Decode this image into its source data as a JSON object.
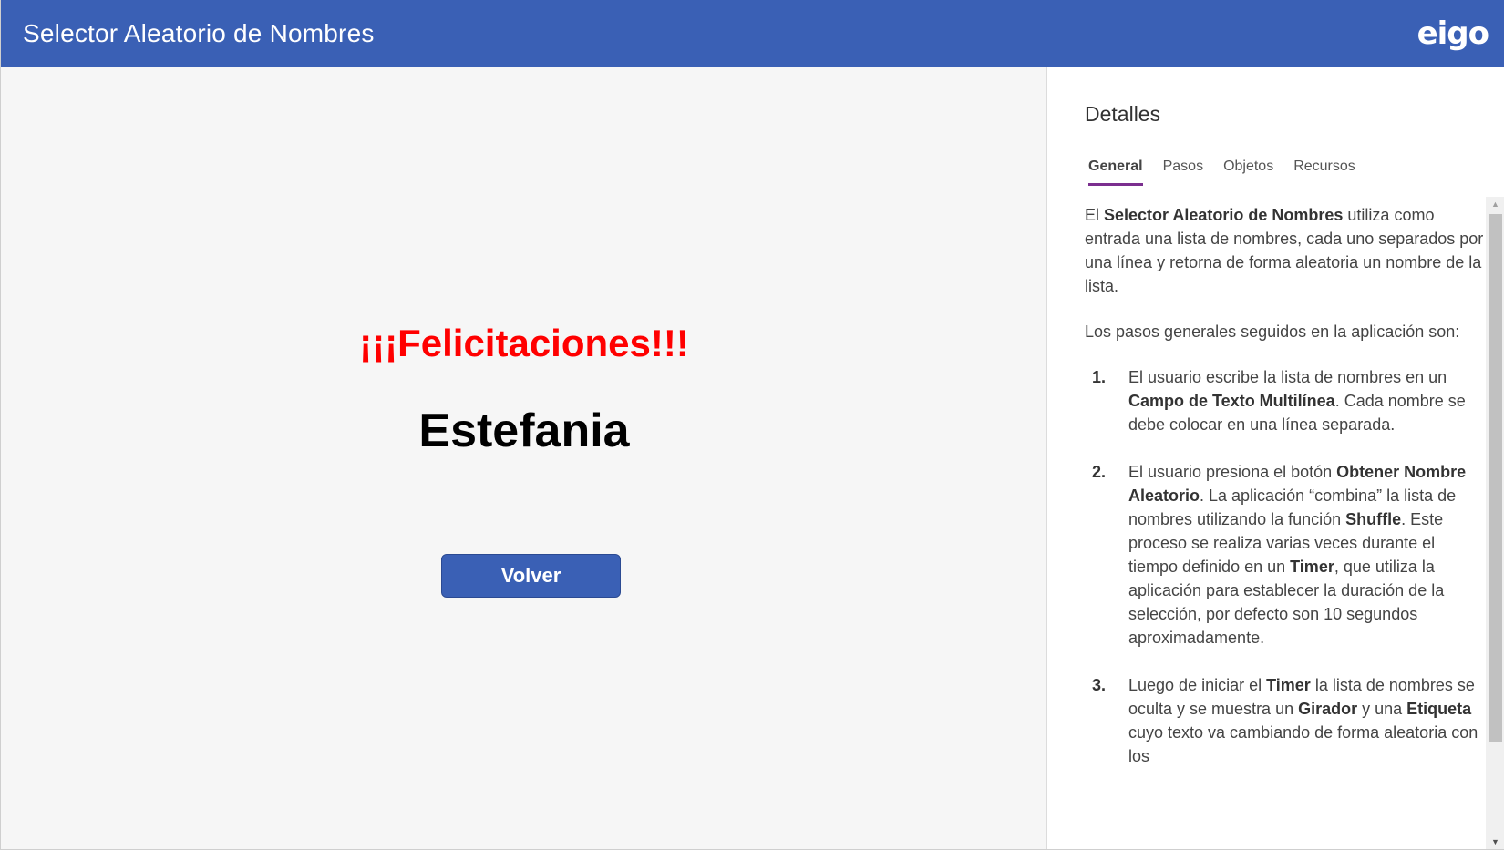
{
  "header": {
    "title": "Selector Aleatorio de Nombres",
    "logo": "eigo"
  },
  "main": {
    "congrats": "¡¡¡Felicitaciones!!!",
    "winner": "Estefania",
    "back_button": "Volver"
  },
  "details": {
    "heading": "Detalles",
    "tabs": [
      {
        "label": "General",
        "active": true
      },
      {
        "label": "Pasos",
        "active": false
      },
      {
        "label": "Objetos",
        "active": false
      },
      {
        "label": "Recursos",
        "active": false
      }
    ],
    "intro": {
      "pre": "El ",
      "bold": "Selector Aleatorio de Nombres",
      "post": " utiliza como entrada una lista de nombres, cada uno separados por una línea y retorna de forma aleatoria un nombre de la lista."
    },
    "steps_intro": "Los pasos generales seguidos en la aplicación son:",
    "steps": [
      {
        "num": "1.",
        "t1": "El usuario escribe la lista de nombres en un ",
        "b1": "Campo de Texto Multilínea",
        "t2": ". Cada nombre se debe colocar en una línea separada."
      },
      {
        "num": "2.",
        "t1": "El usuario presiona el botón ",
        "b1": "Obtener Nombre Aleatorio",
        "t2": ". La aplicación “combina” la lista de nombres utilizando la función ",
        "b2": "Shuffle",
        "t3": ". Este proceso se realiza varias veces durante el tiempo definido en un ",
        "b3": "Timer",
        "t4": ", que utiliza la aplicación para establecer la duración de la selección, por defecto son 10 segundos aproximadamente."
      },
      {
        "num": "3.",
        "t1": "Luego de iniciar el ",
        "b1": "Timer",
        "t2": " la lista de nombres se oculta y se muestra un ",
        "b2": "Girador",
        "t3": " y una ",
        "b3": "Etiqueta",
        "t4": " cuyo texto va cambiando de forma aleatoria con los"
      }
    ]
  },
  "colors": {
    "header_bg": "#3a60b5",
    "congrats": "#ff0000",
    "tab_underline": "#7b2f8f"
  }
}
